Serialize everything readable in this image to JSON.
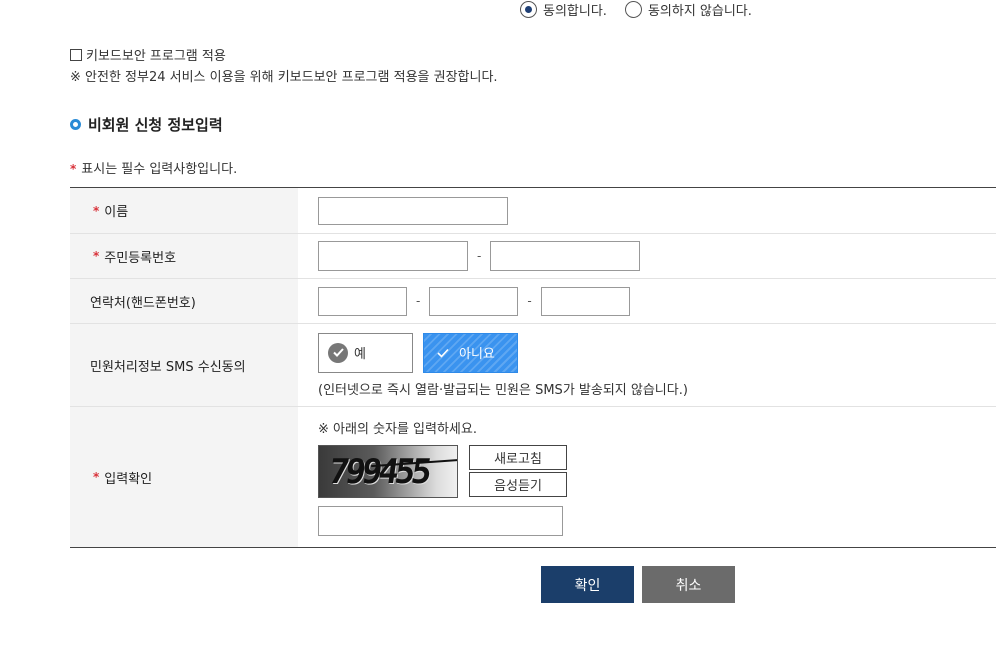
{
  "consent": {
    "agree_label": "동의합니다.",
    "disagree_label": "동의하지 않습니다."
  },
  "keyboard_security": {
    "checkbox_label": "키보드보안 프로그램 적용",
    "notice": "※ 안전한 정부24 서비스 이용을 위해 키보드보안 프로그램 적용을 권장합니다."
  },
  "section": {
    "title": "비회원 신청 정보입력",
    "required_note": "표시는 필수 입력사항입니다.",
    "required_star": "*"
  },
  "form": {
    "name_label": "이름",
    "rrn_label": "주민등록번호",
    "phone_label": "연락처(핸드폰번호)",
    "sms_label": "민원처리정보 SMS 수신동의",
    "sms_yes": "예",
    "sms_no": "아니요",
    "sms_note": "(인터넷으로 즉시 열람·발급되는 민원은 SMS가 발송되지 않습니다.)",
    "captcha_label": "입력확인",
    "captcha_instruction": "※ 아래의 숫자를 입력하세요.",
    "captcha_value": "799455",
    "refresh_label": "새로고침",
    "audio_label": "음성듣기",
    "dash": "-"
  },
  "actions": {
    "confirm": "확인",
    "cancel": "취소"
  },
  "colors": {
    "confirm_bg": "#1b3e6a",
    "cancel_bg": "#6b6b6b",
    "accent_blue": "#2a8bd6",
    "required_red": "#d9333b"
  }
}
